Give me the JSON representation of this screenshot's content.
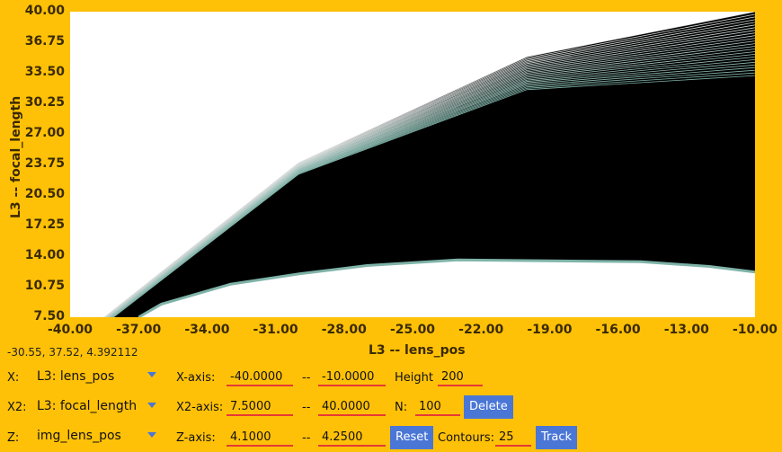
{
  "chart_data": {
    "type": "heatmap",
    "xlabel": "L3 -- lens_pos",
    "ylabel": "L3 -- focal_length",
    "xlim": [
      -40,
      -10
    ],
    "ylim": [
      7.5,
      40
    ],
    "x_ticks": [
      "-40.00",
      "-37.00",
      "-34.00",
      "-31.00",
      "-28.00",
      "-25.00",
      "-22.00",
      "-19.00",
      "-16.00",
      "-13.00",
      "-10.00"
    ],
    "y_ticks": [
      "40.00",
      "36.75",
      "33.50",
      "30.25",
      "27.00",
      "23.75",
      "20.50",
      "17.25",
      "14.00",
      "10.75",
      "7.50"
    ],
    "contour_lines": 25,
    "colors": {
      "fill": "#000000",
      "contour_low": "#7fb3a8",
      "contour_high": "#e0e0e0",
      "background": "#ffffff"
    }
  },
  "readout": "-30.55, 37.52, 4.392112",
  "controls": {
    "x": {
      "label": "X:",
      "value": "L3: lens_pos"
    },
    "x2": {
      "label": "X2:",
      "value": "L3: focal_length"
    },
    "z": {
      "label": "Z:",
      "value": "img_lens_pos"
    },
    "x_axis": {
      "label": "X-axis:",
      "min": "-40.0000",
      "max": "-10.0000"
    },
    "x2_axis": {
      "label": "X2-axis:",
      "min": "7.5000",
      "max": "40.0000"
    },
    "z_axis": {
      "label": "Z-axis:",
      "min": "4.1000",
      "max": "4.2500"
    },
    "dash": "--",
    "height": {
      "label": "Height",
      "value": "200"
    },
    "n": {
      "label": "N:",
      "value": "100"
    },
    "contours": {
      "label": "Contours:",
      "value": "25"
    },
    "buttons": {
      "delete": "Delete",
      "reset": "Reset",
      "track": "Track"
    }
  }
}
